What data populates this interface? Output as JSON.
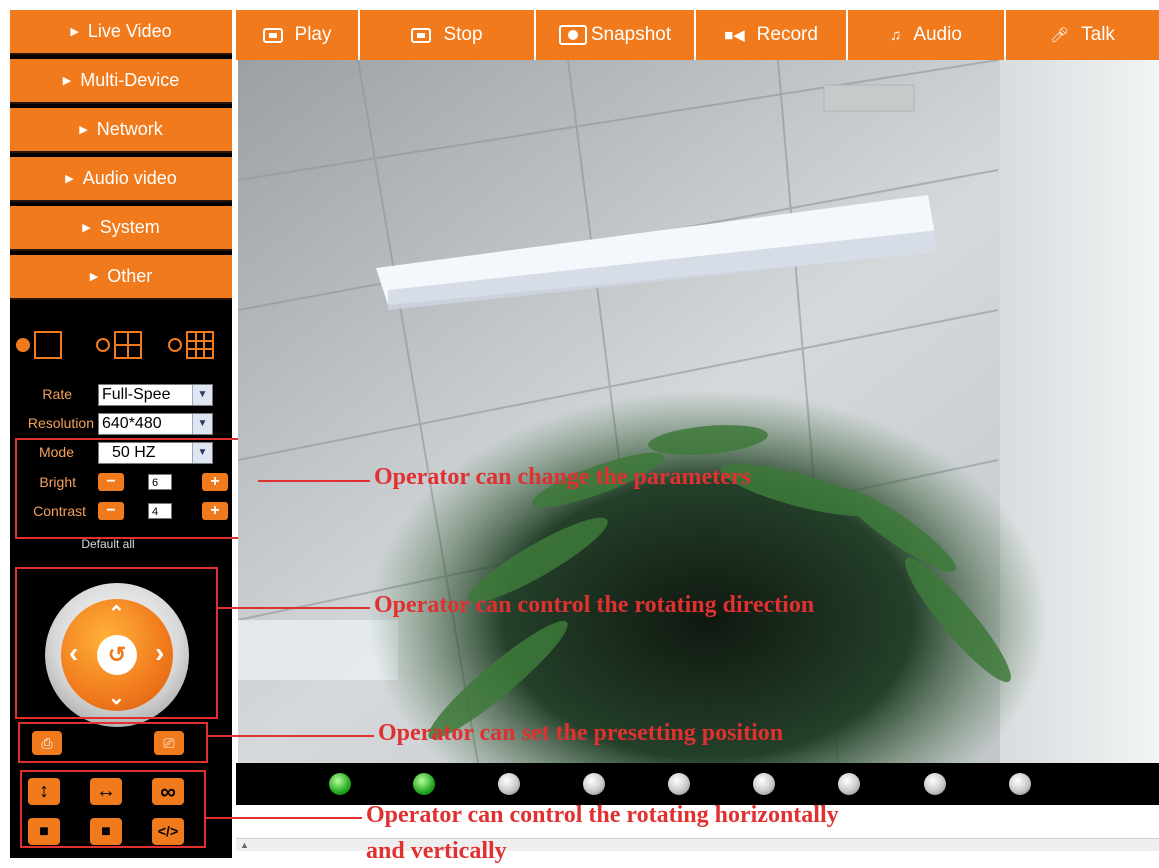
{
  "sidebar": {
    "menu": [
      {
        "label": "Live Video"
      },
      {
        "label": "Multi-Device"
      },
      {
        "label": "Network"
      },
      {
        "label": "Audio video"
      },
      {
        "label": "System"
      },
      {
        "label": "Other"
      }
    ],
    "layouts": [
      {
        "icon": "single-view-icon",
        "selected": true
      },
      {
        "icon": "quad-view-icon",
        "selected": false
      },
      {
        "icon": "nine-view-icon",
        "selected": false
      }
    ],
    "params": {
      "rate": {
        "label": "Rate",
        "value": "Full-Spee"
      },
      "resolution": {
        "label": "Resolution",
        "value": "640*480"
      },
      "mode": {
        "label": "Mode",
        "value": "50 HZ"
      },
      "bright": {
        "label": "Bright",
        "value": "6"
      },
      "contrast": {
        "label": "Contrast",
        "value": "4"
      },
      "minus_glyph": "−",
      "plus_glyph": "+"
    },
    "default_all": "Default all",
    "ptz": {
      "center_glyph": "↺",
      "up": "⌃",
      "down": "⌄",
      "left": "‹",
      "right": "›"
    },
    "preset": {
      "set_glyph": "⎙",
      "call_glyph": "⎚"
    },
    "tools": {
      "vertical_glyph": "↕",
      "horizontal_glyph": "↔",
      "loop_glyph": "∞",
      "stop1_glyph": "■",
      "stop2_glyph": "■",
      "code_glyph": "</>"
    }
  },
  "toolbar": {
    "buttons": [
      {
        "label": "Play",
        "icon": "play-icon"
      },
      {
        "label": "Stop",
        "icon": "stop-icon"
      },
      {
        "label": "Snapshot",
        "icon": "snapshot-icon"
      },
      {
        "label": "Record",
        "icon": "record-icon"
      },
      {
        "label": "Audio",
        "icon": "audio-icon"
      },
      {
        "label": "Talk",
        "icon": "talk-icon"
      }
    ]
  },
  "status_dots": [
    "green",
    "green",
    "gray",
    "gray",
    "gray",
    "gray",
    "gray",
    "gray",
    "gray"
  ],
  "annotations": {
    "params": "Operator can change the parameters",
    "direction": "Operator can control the rotating direction",
    "preset": "Operator can set the presetting position",
    "rotate_line1": "Operator can control the rotating horizontally",
    "rotate_line2": "and vertically"
  },
  "colors": {
    "accent": "#f07a1c",
    "annotation": "#e03030",
    "sidebar_bg": "#000000"
  }
}
